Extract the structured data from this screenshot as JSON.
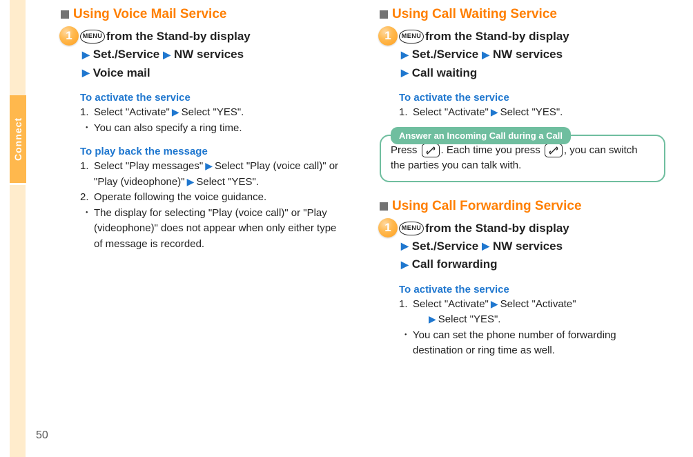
{
  "sidebar": {
    "label": "Connect"
  },
  "page_number": "50",
  "menu_key": "MENU",
  "left": {
    "sections": [
      {
        "title": "Using Voice Mail Service",
        "step_num": "1",
        "path": {
          "prefix": "from the Stand-by display",
          "p1": "Set./Service",
          "p2": "NW services",
          "p3": "Voice mail"
        },
        "groups": [
          {
            "heading": "To activate the service",
            "items": [
              {
                "type": "num",
                "n": "1.",
                "t_before": "Select \"Activate\"",
                "t_after": "Select \"YES\"."
              },
              {
                "type": "bul",
                "b": "･",
                "t": "You can also specify a ring time."
              }
            ]
          },
          {
            "heading": "To play back the message",
            "items": [
              {
                "type": "num",
                "n": "1.",
                "t_before": "Select \"Play messages\"",
                "t_mid": "Select \"Play (voice call)\" or \"Play (videophone)\"",
                "t_after": "Select \"YES\"."
              },
              {
                "type": "num",
                "n": "2.",
                "t": "Operate following the voice guidance."
              },
              {
                "type": "bul",
                "b": "･",
                "t": "The display for selecting \"Play (voice call)\" or \"Play (videophone)\" does not appear when only either type of message is recorded."
              }
            ]
          }
        ]
      }
    ]
  },
  "right": {
    "sections": [
      {
        "title": "Using Call Waiting Service",
        "step_num": "1",
        "path": {
          "prefix": "from the Stand-by display",
          "p1": "Set./Service",
          "p2": "NW services",
          "p3": "Call waiting"
        },
        "groups": [
          {
            "heading": "To activate the service",
            "items": [
              {
                "type": "num",
                "n": "1.",
                "t_before": "Select \"Activate\"",
                "t_after": "Select \"YES\"."
              }
            ]
          }
        ],
        "tip": {
          "label": "Answer an Incoming Call during a Call",
          "before": "Press ",
          "mid": ". Each time you press ",
          "after": ", you can switch the parties you can talk with."
        }
      },
      {
        "title": "Using Call Forwarding Service",
        "step_num": "1",
        "path": {
          "prefix": "from the Stand-by display",
          "p1": "Set./Service",
          "p2": "NW services",
          "p3": "Call forwarding"
        },
        "groups": [
          {
            "heading": "To activate the service",
            "items": [
              {
                "type": "num",
                "n": "1.",
                "t_before": "Select \"Activate\"",
                "t_mid": "Select \"Activate\"",
                "t_after_newline": "Select \"YES\"."
              },
              {
                "type": "bul",
                "b": "･",
                "t": "You can set the phone number of forwarding destination or ring time as well."
              }
            ]
          }
        ]
      }
    ]
  }
}
